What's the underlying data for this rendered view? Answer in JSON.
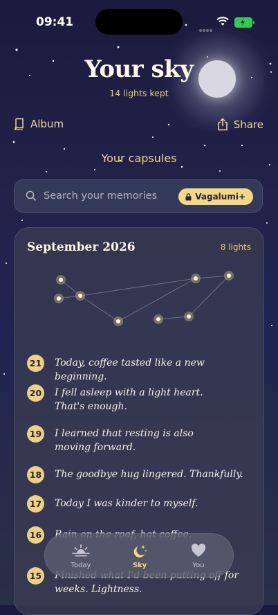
{
  "status_bar": {
    "time": "09:41"
  },
  "header": {
    "title": "Your sky",
    "subtitle": "14 lights kept",
    "album_label": "Album",
    "share_label": "Share",
    "section_label": "Your capsules"
  },
  "search": {
    "placeholder": "Search your memories",
    "badge_label": "Vagalumi+"
  },
  "month_card": {
    "title": "September 2026",
    "count": "8 lights",
    "entries": [
      {
        "day": "21",
        "text": "Today, coffee tasted like a new beginning."
      },
      {
        "day": "20",
        "text": "I fell asleep with a light heart.\nThat's enough."
      },
      {
        "day": "19",
        "text": "I learned that resting is also\nmoving forward."
      },
      {
        "day": "18",
        "text": "The goodbye hug lingered. Thankfully."
      },
      {
        "day": "17",
        "text": "Today I was kinder to myself."
      },
      {
        "day": "16",
        "text": "Rain on the roof, hot coffee."
      },
      {
        "day": "15",
        "text": "Finished what I'd been putting off for\nweeks. Lightness."
      }
    ]
  },
  "tab_bar": {
    "tabs": [
      {
        "label": "Today",
        "icon": "sunrise-icon"
      },
      {
        "label": "Sky",
        "icon": "moon-stars-icon",
        "active": true
      },
      {
        "label": "You",
        "icon": "heart-icon"
      }
    ]
  },
  "colors": {
    "accent": "#f4d886",
    "background": "#1f2450"
  }
}
